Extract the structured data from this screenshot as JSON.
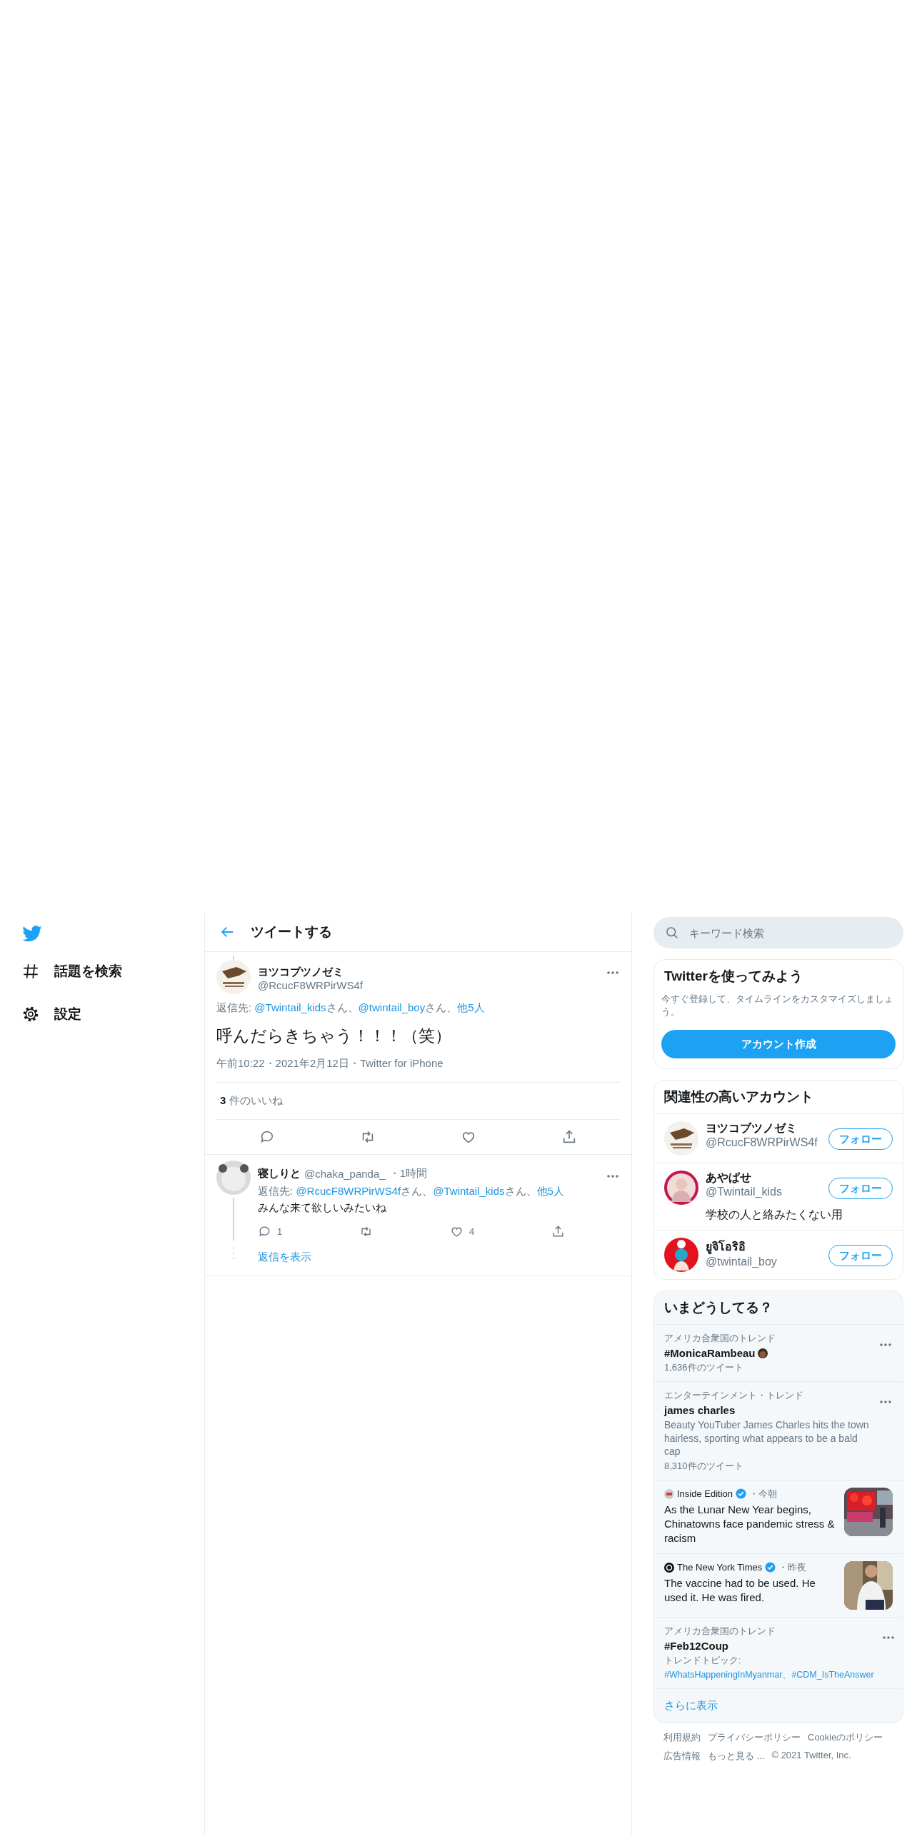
{
  "nav": {
    "items": [
      {
        "kind": "explore",
        "label": "話題を検索"
      },
      {
        "kind": "settings",
        "label": "設定"
      }
    ]
  },
  "header": {
    "title": "ツイートする"
  },
  "tweet": {
    "avatar": {
      "kind": "insect"
    },
    "name": "ヨツコブツノゼミ",
    "handle": "@RcucF8WRPirWS4f",
    "reply_to": {
      "label": "返信先: ",
      "mentions": [
        {
          "handle": "@Twintail_kids",
          "suffix": "さん、"
        },
        {
          "handle": "@twintail_boy",
          "suffix": "さん、"
        }
      ],
      "others": "他5人"
    },
    "text": "呼んだらきちゃう！！！（笑）",
    "meta": "午前10:22・2021年2月12日・Twitter for iPhone",
    "likes": "**3** 件のいいね",
    "actions": [
      {
        "kind": "reply"
      },
      {
        "kind": "retweet"
      },
      {
        "kind": "like"
      },
      {
        "kind": "share"
      }
    ]
  },
  "replies": [
    {
      "avatar": {
        "kind": "panda"
      },
      "name": "寝しりと",
      "handle": "@chaka_panda_",
      "time": "・1時間",
      "reply_to": {
        "label": "返信先: ",
        "mentions": [
          {
            "handle": "@RcucF8WRPirWS4f",
            "suffix": "さん、"
          },
          {
            "handle": "@Twintail_kids",
            "suffix": "さん、"
          }
        ],
        "others": "他5人"
      },
      "text": "みんな来て欲しいみたいね",
      "actions": [
        {
          "kind": "reply",
          "count": "1"
        },
        {
          "kind": "retweet"
        },
        {
          "kind": "like",
          "count": "4"
        },
        {
          "kind": "share"
        }
      ],
      "show_replies": "返信を表示"
    }
  ],
  "search": {
    "placeholder": "キーワード検索"
  },
  "signup": {
    "title": "Twitterを使ってみよう",
    "text": "今すぐ登録して、タイムラインをカスタマイズしましょう。",
    "button": "アカウント作成"
  },
  "who_to_follow": {
    "title": "関連性の高いアカウント",
    "accounts": [
      {
        "avatar": {
          "kind": "insect"
        },
        "name": "ヨツコブツノゼミ",
        "handle": "@RcucF8WRPirWS4f",
        "button": "フォロー"
      },
      {
        "avatar": {
          "kind": "girl"
        },
        "name": "あやぱせ",
        "handle": "@Twintail_kids",
        "bio": "学校の人と絡みたくない用",
        "button": "フォロー"
      },
      {
        "avatar": {
          "kind": "boy"
        },
        "name": "ยูจิโอริอิ",
        "handle": "@twintail_boy",
        "button": "フォロー"
      }
    ]
  },
  "trends": {
    "title": "いまどうしてる？",
    "items": [
      {
        "kind": "trend",
        "context": "アメリカ合衆国のトレンド",
        "title": "#MonicaRambeau",
        "emoji": true,
        "count": "1,636件のツイート"
      },
      {
        "kind": "trend",
        "context": "エンターテインメント・トレンド",
        "title": "james charles",
        "emoji": false,
        "description": "Beauty YouTuber James Charles hits the town hairless, sporting what appears to be a bald cap",
        "count": "8,310件のツイート"
      },
      {
        "kind": "news",
        "logo": {
          "kind": "tv"
        },
        "source": "Inside Edition",
        "time": "・今朝",
        "headline": "As the Lunar New Year begins, Chinatowns face pandemic stress & racism"
      },
      {
        "kind": "news",
        "logo": {
          "kind": "paper"
        },
        "source": "The New York Times",
        "time": "・昨夜",
        "headline": "The vaccine had to be used. He used it. He was fired."
      },
      {
        "kind": "trend",
        "context": "アメリカ合衆国のトレンド",
        "title": "#Feb12Coup",
        "emoji": false,
        "topics_label": "トレンドトピック:",
        "topics": "#WhatsHappeningInMyanmar、#CDM_IsTheAnswer"
      }
    ],
    "more": "さらに表示"
  },
  "footer": [
    [
      "利用規約",
      "プライバシーポリシー",
      "Cookieのポリシー"
    ],
    [
      "広告情報",
      "もっと見る ...",
      "© 2021 Twitter, Inc."
    ]
  ]
}
